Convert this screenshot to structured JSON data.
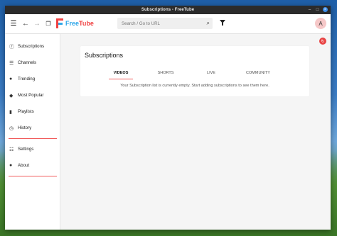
{
  "window": {
    "title": "Subscriptions - FreeTube"
  },
  "app": {
    "name_free": "Free",
    "name_tube": "Tube"
  },
  "search": {
    "placeholder": "Search / Go to URL"
  },
  "user": {
    "avatar_letter": "A"
  },
  "sidebar": {
    "items": [
      {
        "label": "Subscriptions",
        "icon": "rss-icon"
      },
      {
        "label": "Channels",
        "icon": "list-icon"
      },
      {
        "label": "Trending",
        "icon": "fire-icon"
      },
      {
        "label": "Most Popular",
        "icon": "users-icon"
      },
      {
        "label": "Playlists",
        "icon": "bookmark-icon"
      },
      {
        "label": "History",
        "icon": "history-icon"
      },
      {
        "label": "Settings",
        "icon": "sliders-icon"
      },
      {
        "label": "About",
        "icon": "info-icon"
      }
    ]
  },
  "main": {
    "title": "Subscriptions",
    "tabs": [
      {
        "label": "VIDEOS",
        "active": true
      },
      {
        "label": "SHORTS",
        "active": false
      },
      {
        "label": "LIVE",
        "active": false
      },
      {
        "label": "COMMUNITY",
        "active": false
      }
    ],
    "empty_message": "Your Subscription list is currently empty. Start adding subscriptions to see them here."
  },
  "colors": {
    "accent": "#f15b5b",
    "brand_blue": "#2ea6e8",
    "brand_red": "#f04242"
  }
}
